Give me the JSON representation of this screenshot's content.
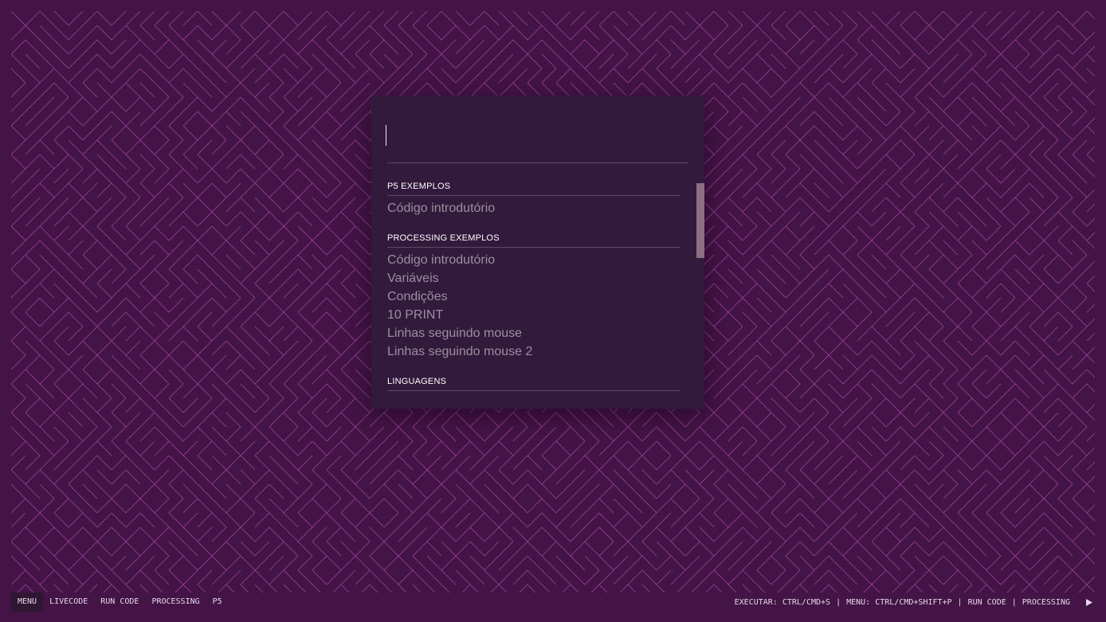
{
  "theme": {
    "background": "#431445",
    "maze_stroke": "#8b3a8c",
    "panel": "#321a3c",
    "accent_text": "#ffffff",
    "item_text": "#9b8ea1"
  },
  "search": {
    "value": "",
    "placeholder": ""
  },
  "menu": {
    "sections": [
      {
        "title": "P5 EXEMPLOS",
        "items": [
          "Código introdutório"
        ]
      },
      {
        "title": "PROCESSING EXEMPLOS",
        "items": [
          "Código introdutório",
          "Variáveis",
          "Condições",
          "10 PRINT",
          "Linhas seguindo mouse",
          "Linhas seguindo mouse 2"
        ]
      },
      {
        "title": "LINGUAGENS",
        "items": []
      }
    ]
  },
  "bottombar": {
    "nav": [
      "MENU",
      "LIVECODE",
      "RUN CODE",
      "PROCESSING",
      "P5"
    ],
    "info": [
      "EXECUTAR: CTRL/CMD+S",
      "MENU: CTRL/CMD+SHIFT+P",
      "RUN CODE",
      "PROCESSING"
    ],
    "separator": "|",
    "run_icon": "play-icon"
  }
}
